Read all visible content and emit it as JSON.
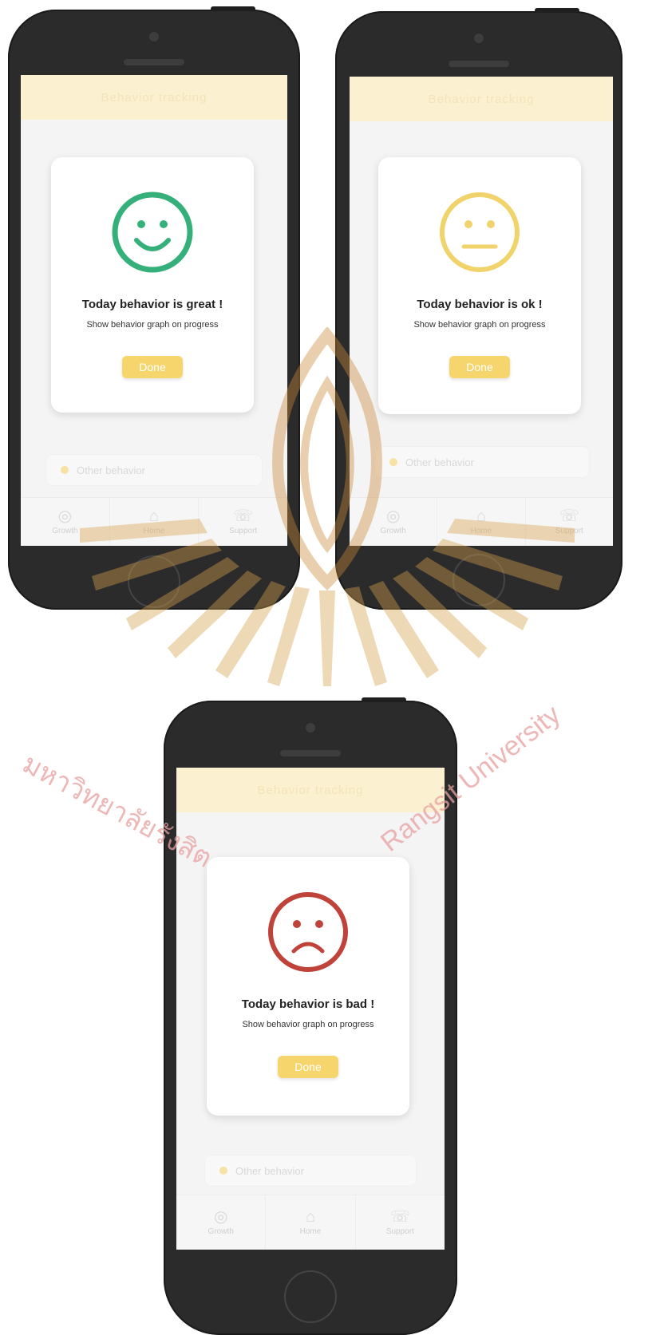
{
  "phones": [
    {
      "header_title": "Behavior tracking",
      "dialog": {
        "mood": "great",
        "face_icon": "smiley-happy-icon",
        "face_color": "#35b07a",
        "title": "Today behavior is great !",
        "subtitle": "Show behavior graph on progress",
        "done_label": "Done"
      },
      "other_label": "Other behavior",
      "nav": [
        {
          "label": "Growth",
          "icon": "growth-icon"
        },
        {
          "label": "Home",
          "icon": "home-icon"
        },
        {
          "label": "Support",
          "icon": "support-icon"
        }
      ]
    },
    {
      "header_title": "Behavior tracking",
      "dialog": {
        "mood": "ok",
        "face_icon": "smiley-neutral-icon",
        "face_color": "#f0d36a",
        "title": "Today behavior is ok !",
        "subtitle": "Show behavior graph on progress",
        "done_label": "Done"
      },
      "other_label": "Other behavior",
      "nav": [
        {
          "label": "Growth",
          "icon": "growth-icon"
        },
        {
          "label": "Home",
          "icon": "home-icon"
        },
        {
          "label": "Support",
          "icon": "support-icon"
        }
      ]
    },
    {
      "header_title": "Behavior tracking",
      "dialog": {
        "mood": "bad",
        "face_icon": "smiley-sad-icon",
        "face_color": "#c0433a",
        "title": "Today behavior is bad !",
        "subtitle": "Show behavior graph on progress",
        "done_label": "Done"
      },
      "other_label": "Other behavior",
      "nav": [
        {
          "label": "Growth",
          "icon": "growth-icon"
        },
        {
          "label": "Home",
          "icon": "home-icon"
        },
        {
          "label": "Support",
          "icon": "support-icon"
        }
      ]
    }
  ],
  "watermark": {
    "text_thai": "มหาวิทยาลัยรังสิต",
    "text_eng": "Rangsit University",
    "color": "#e8a0a0"
  },
  "theme": {
    "accent": "#f5d56c",
    "header_bg": "#fbf0cf"
  }
}
